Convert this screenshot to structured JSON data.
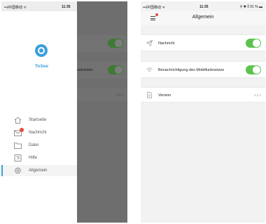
{
  "status_bar": {
    "carrier": "••ıl中国移动 ᯤ",
    "time": "11:35",
    "right_indicators": "⚲ ✱ ⁑ 91 % ▬"
  },
  "drawer": {
    "app_name": "ToSee",
    "items": [
      {
        "label": "Startseite",
        "icon": "home-icon"
      },
      {
        "label": "Nachricht",
        "icon": "message-icon",
        "badge": true
      },
      {
        "label": "Datei",
        "icon": "folder-icon"
      },
      {
        "label": "Hilfe",
        "icon": "help-icon"
      },
      {
        "label": "Allgemein",
        "icon": "settings-icon",
        "active": true
      }
    ]
  },
  "background_screen": {
    "row2_text": "unknetzes",
    "version_text": "2.2.1"
  },
  "settings": {
    "title": "Allgemein",
    "rows": [
      {
        "label": "Nachricht",
        "icon": "paper-plane-icon",
        "toggle_on": true
      },
      {
        "label": "Benachrichtigung des Mobilfunknetzes",
        "icon": "wifi-icon",
        "toggle_on": true
      },
      {
        "label": "Version",
        "icon": "document-icon",
        "value": "2.2.1"
      }
    ]
  },
  "colors": {
    "accent": "#3aa0dc",
    "toggle_on": "#5cc34e",
    "badge": "#e74c3c"
  }
}
